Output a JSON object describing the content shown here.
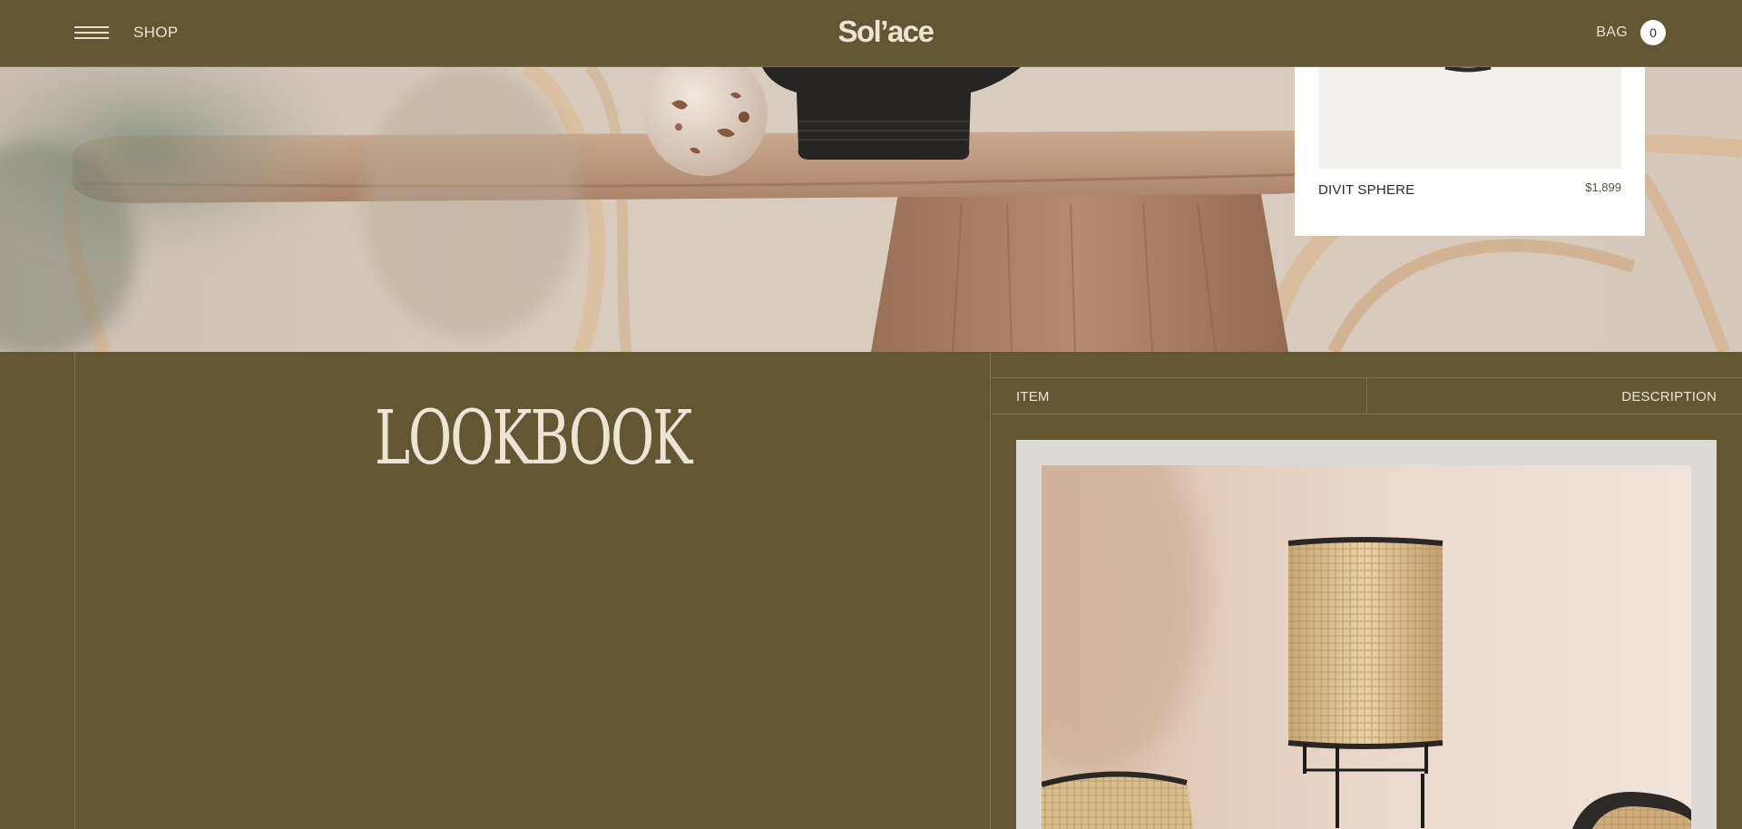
{
  "header": {
    "menu_icon": "hamburger-menu-icon",
    "shop_label": "SHOP",
    "logo_text": "Sol’ace",
    "bag_label": "BAG",
    "bag_count": "0"
  },
  "featured_product": {
    "name": "DIVIT SPHERE",
    "price": "$1,899"
  },
  "lookbook": {
    "title": "LOOKBOOK",
    "table_headers": {
      "item": "ITEM",
      "description": "DESCRIPTION"
    }
  },
  "colors": {
    "background": "#635632",
    "text": "#ece5d6",
    "card": "#ffffff"
  }
}
